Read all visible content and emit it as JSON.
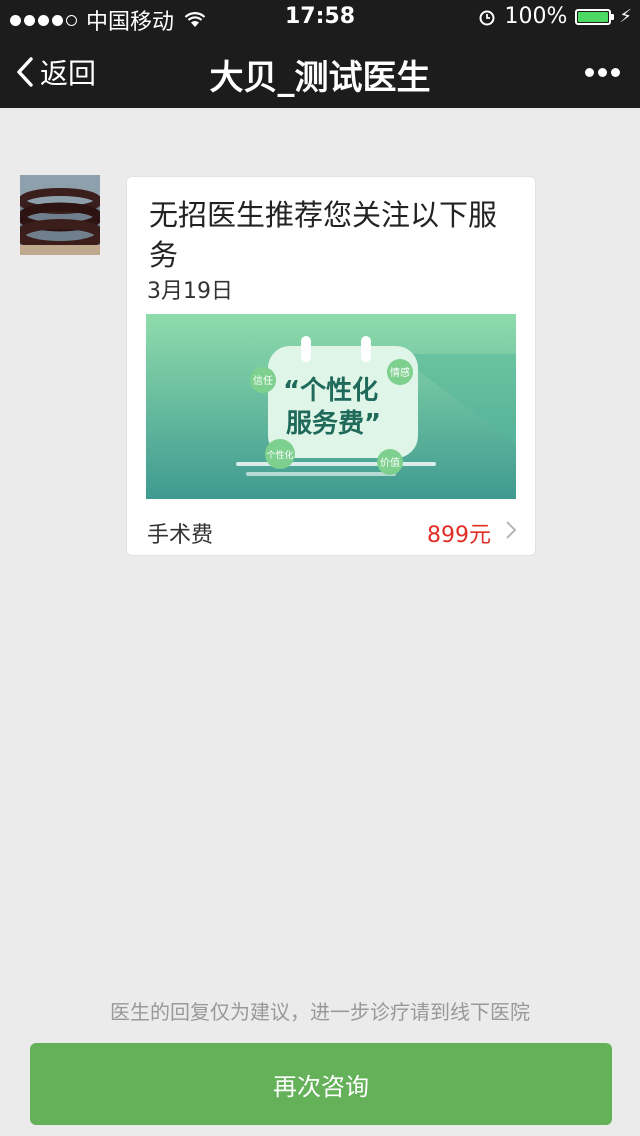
{
  "status": {
    "carrier": "中国移动",
    "time": "17:58",
    "battery": "100%",
    "battery_level": 1.0
  },
  "nav": {
    "back_label": "返回",
    "title": "大贝_测试医生"
  },
  "message": {
    "card": {
      "title": "无招医生推荐您关注以下服务",
      "date": "3月19日",
      "banner": {
        "headline_line1": "“个性化",
        "headline_line2": "服务费”",
        "tags": [
          "信任",
          "情感",
          "个性化",
          "价值"
        ]
      },
      "item_label": "手术费",
      "price": "899元"
    }
  },
  "footer": {
    "disclaimer": "医生的回复仅为建议，进一步诊疗请到线下医院",
    "consult_button": "再次咨询"
  },
  "colors": {
    "accent_green": "#64b15a",
    "price_red": "#e02e24",
    "nav_bg": "#1c1c1c"
  }
}
